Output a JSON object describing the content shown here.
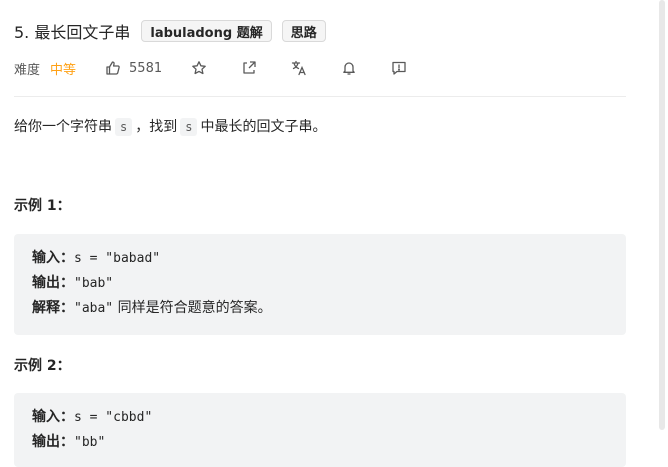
{
  "problem": {
    "title": "5. 最长回文子串",
    "tags": [
      "labuladong 题解",
      "思路"
    ]
  },
  "meta": {
    "difficulty_label": "难度",
    "difficulty_value": "中等",
    "like_count": "5581",
    "icons": [
      "thumbs-up-icon",
      "star-icon",
      "share-icon",
      "translate-icon",
      "bell-icon",
      "feedback-icon"
    ],
    "difficulty_color": "#ffa116"
  },
  "description": {
    "part1": "给你一个字符串",
    "code1": "s",
    "part2": "，找到",
    "code2": "s",
    "part3": "中最长的回文子串。"
  },
  "examples": [
    {
      "heading": "示例 1：",
      "input_label": "输入：",
      "input_value": "s = \"babad\"",
      "output_label": "输出：",
      "output_value": "\"bab\"",
      "explanation_label": "解释：",
      "explanation_code": "\"aba\"",
      "explanation_text": "同样是符合题意的答案。"
    },
    {
      "heading": "示例 2：",
      "input_label": "输入：",
      "input_value": "s = \"cbbd\"",
      "output_label": "输出：",
      "output_value": "\"bb\""
    }
  ]
}
